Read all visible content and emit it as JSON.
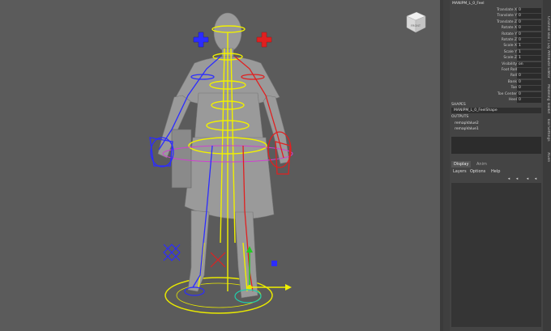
{
  "node_name": "MANIPM_L_0_Feel",
  "attributes": [
    {
      "label": "Translate X",
      "value": "0"
    },
    {
      "label": "Translate Y",
      "value": "0"
    },
    {
      "label": "Translate Z",
      "value": "0"
    },
    {
      "label": "Rotate X",
      "value": "0"
    },
    {
      "label": "Rotate Y",
      "value": "0"
    },
    {
      "label": "Rotate Z",
      "value": "0"
    },
    {
      "label": "Scale X",
      "value": "1"
    },
    {
      "label": "Scale Y",
      "value": "1"
    },
    {
      "label": "Scale Z",
      "value": "1"
    },
    {
      "label": "Visibility",
      "value": "on"
    },
    {
      "label": "Foot Roll",
      "value": ""
    },
    {
      "label": "Roll",
      "value": "0"
    },
    {
      "label": "Bank",
      "value": "0"
    },
    {
      "label": "Toe",
      "value": "0"
    },
    {
      "label": "Toe Center",
      "value": "0"
    },
    {
      "label": "Heel",
      "value": "0"
    }
  ],
  "shapes_header": "SHAPES",
  "shape_name": "MANIPM_L_0_FeelShape",
  "outputs_header": "OUTPUTS",
  "outputs": [
    "remapValue2",
    "remapValue1"
  ],
  "layer_editor": {
    "tabs": [
      "Display",
      "Anim"
    ],
    "menu": [
      "Layers",
      "Options",
      "Help"
    ]
  },
  "side_tabs": [
    "Attribute Editor",
    "Modeling Toolkit",
    "Tool Settings",
    "Channel Box / Layer Editor",
    "XGen"
  ],
  "viewcube_label": "FRONT",
  "colors": {
    "viewport_bg": "#5b5b5b",
    "panel_bg": "#444444",
    "left_controls": "#2c2cff",
    "right_controls": "#e02020",
    "center_controls": "#f0f000",
    "accent_ring": "#d040d0"
  },
  "icons": [
    "viewcube-icon",
    "new-layer-icon",
    "delete-layer-icon",
    "layer-up-icon",
    "layer-down-icon"
  ]
}
